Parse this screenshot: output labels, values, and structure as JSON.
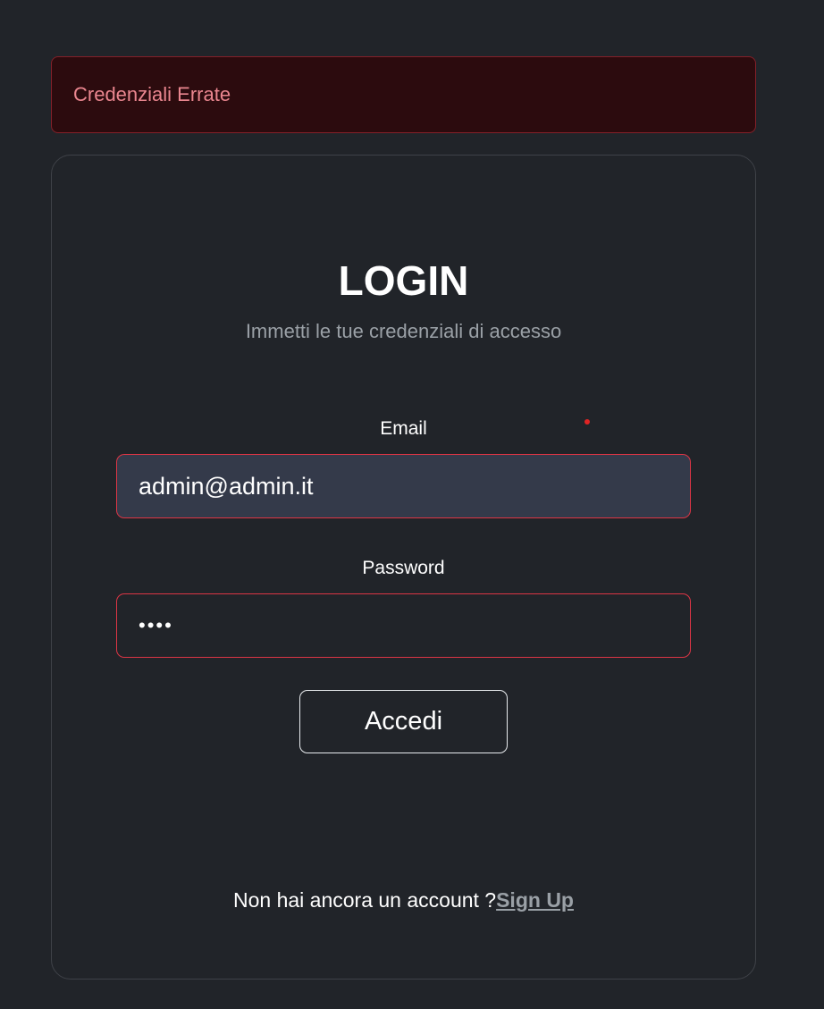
{
  "alert": {
    "message": "Credenziali Errate"
  },
  "login": {
    "title": "LOGIN",
    "subtitle": "Immetti le tue credenziali di accesso",
    "email_label": "Email",
    "email_value": "admin@admin.it",
    "password_label": "Password",
    "password_masked": "••••",
    "submit_label": "Accedi",
    "signup_prompt": "Non hai ancora un account ?",
    "signup_link": "Sign Up"
  },
  "colors": {
    "background": "#212429",
    "alert_background": "#2c0b0e",
    "alert_border": "#842029",
    "alert_text": "#ea868f",
    "invalid_border": "#dc3545",
    "email_field_background": "#343a4a"
  }
}
